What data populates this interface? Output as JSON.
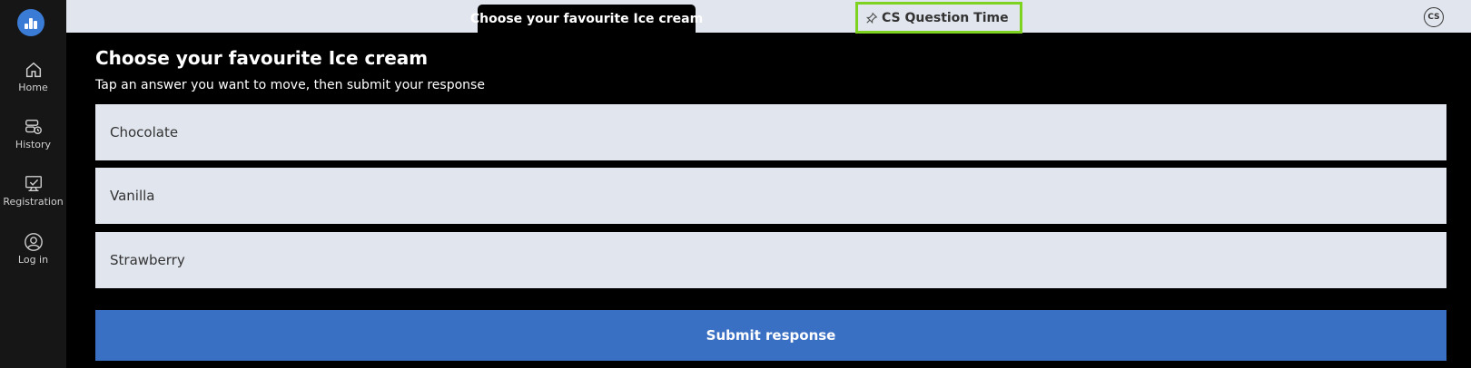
{
  "sidebar": {
    "items": [
      {
        "label": "Home",
        "icon": "home-icon"
      },
      {
        "label": "History",
        "icon": "history-icon"
      },
      {
        "label": "Registration",
        "icon": "registration-icon"
      },
      {
        "label": "Log in",
        "icon": "login-icon"
      }
    ]
  },
  "header": {
    "active_tab": "Choose your favourite Ice cream",
    "pinned_tab": "CS Question Time",
    "avatar_initials": "CS"
  },
  "main": {
    "title": "Choose your favourite Ice cream",
    "instruction": "Tap an answer you want to move, then submit your response",
    "answers": [
      "Chocolate",
      "Vanilla",
      "Strawberry"
    ],
    "submit_label": "Submit response"
  },
  "colors": {
    "accent": "#3a70c3",
    "highlight": "#7ed321",
    "sidebar_bg": "#161616",
    "answer_bg": "#e1e5ee"
  }
}
